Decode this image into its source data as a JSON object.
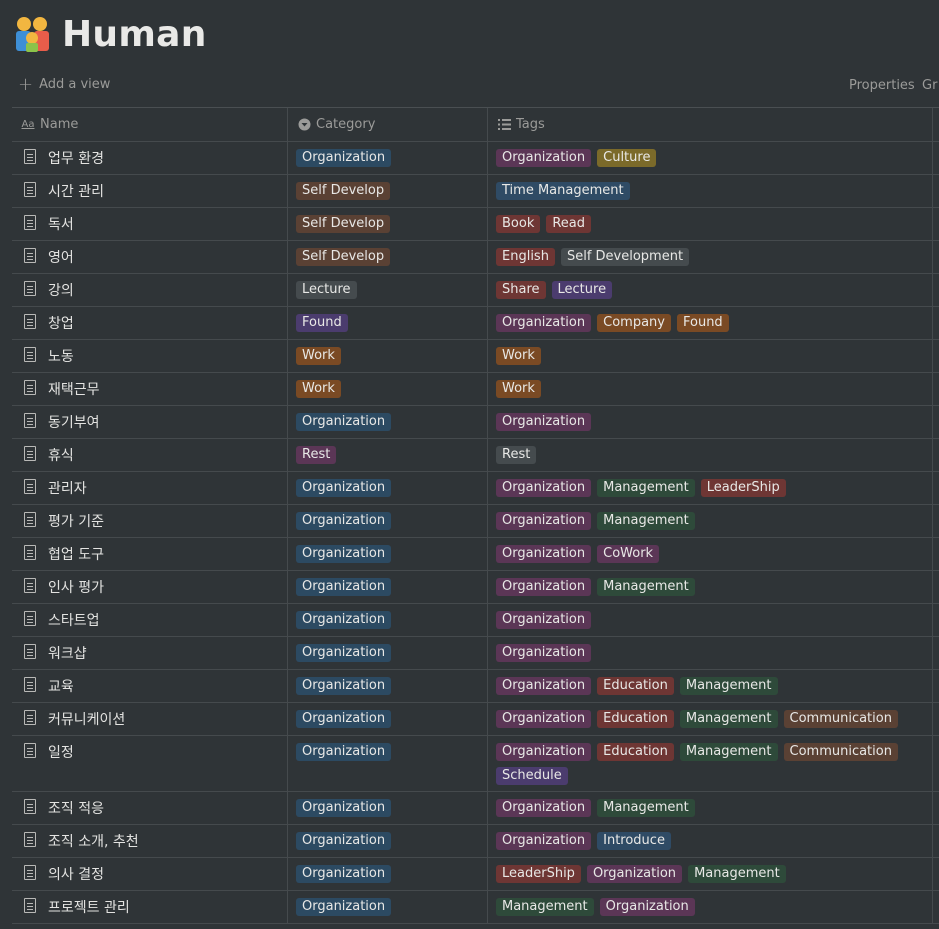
{
  "page": {
    "title": "Human",
    "icon": "family-emoji-icon"
  },
  "viewbar": {
    "add_view": "Add a view",
    "properties": "Properties",
    "group": "Gr"
  },
  "columns": {
    "name": "Name",
    "category": "Category",
    "tags": "Tags"
  },
  "colors": {
    "background": "#2f3437",
    "blue": "#2c4a62",
    "brown": "#5a4134",
    "gray": "#454b4e",
    "purple": "#4b3c6e",
    "orange": "#7a4a24",
    "red": "#6e3634",
    "pink": "#5b3656",
    "yellow": "#7b6a2a",
    "green": "#2e4a3a"
  },
  "rows": [
    {
      "name": "업무 환경",
      "category": {
        "label": "Organization",
        "color": "blue"
      },
      "tags": [
        {
          "label": "Organization",
          "color": "pink"
        },
        {
          "label": "Culture",
          "color": "yellow"
        }
      ]
    },
    {
      "name": "시간 관리",
      "category": {
        "label": "Self Develop",
        "color": "brown"
      },
      "tags": [
        {
          "label": "Time Management",
          "color": "tblue"
        }
      ]
    },
    {
      "name": "독서",
      "category": {
        "label": "Self Develop",
        "color": "brown"
      },
      "tags": [
        {
          "label": "Book",
          "color": "red"
        },
        {
          "label": "Read",
          "color": "red"
        }
      ]
    },
    {
      "name": "영어",
      "category": {
        "label": "Self Develop",
        "color": "brown"
      },
      "tags": [
        {
          "label": "English",
          "color": "red"
        },
        {
          "label": "Self Development",
          "color": "gray"
        }
      ]
    },
    {
      "name": "강의",
      "category": {
        "label": "Lecture",
        "color": "gray"
      },
      "tags": [
        {
          "label": "Share",
          "color": "red"
        },
        {
          "label": "Lecture",
          "color": "purple"
        }
      ]
    },
    {
      "name": "창업",
      "category": {
        "label": "Found",
        "color": "purple"
      },
      "tags": [
        {
          "label": "Organization",
          "color": "pink"
        },
        {
          "label": "Company",
          "color": "orange"
        },
        {
          "label": "Found",
          "color": "orange"
        }
      ]
    },
    {
      "name": "노동",
      "category": {
        "label": "Work",
        "color": "orange"
      },
      "tags": [
        {
          "label": "Work",
          "color": "orange"
        }
      ]
    },
    {
      "name": "재택근무",
      "category": {
        "label": "Work",
        "color": "orange"
      },
      "tags": [
        {
          "label": "Work",
          "color": "orange"
        }
      ]
    },
    {
      "name": "동기부여",
      "category": {
        "label": "Organization",
        "color": "blue"
      },
      "tags": [
        {
          "label": "Organization",
          "color": "pink"
        }
      ]
    },
    {
      "name": "휴식",
      "category": {
        "label": "Rest",
        "color": "pink"
      },
      "tags": [
        {
          "label": "Rest",
          "color": "gray"
        }
      ]
    },
    {
      "name": "관리자",
      "category": {
        "label": "Organization",
        "color": "blue"
      },
      "tags": [
        {
          "label": "Organization",
          "color": "pink"
        },
        {
          "label": "Management",
          "color": "green"
        },
        {
          "label": "LeaderShip",
          "color": "red"
        }
      ]
    },
    {
      "name": "평가 기준",
      "category": {
        "label": "Organization",
        "color": "blue"
      },
      "tags": [
        {
          "label": "Organization",
          "color": "pink"
        },
        {
          "label": "Management",
          "color": "green"
        }
      ]
    },
    {
      "name": "협업 도구",
      "category": {
        "label": "Organization",
        "color": "blue"
      },
      "tags": [
        {
          "label": "Organization",
          "color": "pink"
        },
        {
          "label": "CoWork",
          "color": "pink"
        }
      ]
    },
    {
      "name": "인사 평가",
      "category": {
        "label": "Organization",
        "color": "blue"
      },
      "tags": [
        {
          "label": "Organization",
          "color": "pink"
        },
        {
          "label": "Management",
          "color": "green"
        }
      ]
    },
    {
      "name": "스타트업",
      "category": {
        "label": "Organization",
        "color": "blue"
      },
      "tags": [
        {
          "label": "Organization",
          "color": "pink"
        }
      ]
    },
    {
      "name": "워크샵",
      "category": {
        "label": "Organization",
        "color": "blue"
      },
      "tags": [
        {
          "label": "Organization",
          "color": "pink"
        }
      ]
    },
    {
      "name": "교육",
      "category": {
        "label": "Organization",
        "color": "blue"
      },
      "tags": [
        {
          "label": "Organization",
          "color": "pink"
        },
        {
          "label": "Education",
          "color": "red"
        },
        {
          "label": "Management",
          "color": "green"
        }
      ]
    },
    {
      "name": "커뮤니케이션",
      "category": {
        "label": "Organization",
        "color": "blue"
      },
      "tags": [
        {
          "label": "Organization",
          "color": "pink"
        },
        {
          "label": "Education",
          "color": "red"
        },
        {
          "label": "Management",
          "color": "green"
        },
        {
          "label": "Communication",
          "color": "brown"
        }
      ]
    },
    {
      "name": "일정",
      "category": {
        "label": "Organization",
        "color": "blue"
      },
      "tags": [
        {
          "label": "Organization",
          "color": "pink"
        },
        {
          "label": "Education",
          "color": "red"
        },
        {
          "label": "Management",
          "color": "green"
        },
        {
          "label": "Communication",
          "color": "brown"
        },
        {
          "label": "Schedule",
          "color": "purple"
        }
      ]
    },
    {
      "name": "조직 적응",
      "category": {
        "label": "Organization",
        "color": "blue"
      },
      "tags": [
        {
          "label": "Organization",
          "color": "pink"
        },
        {
          "label": "Management",
          "color": "green"
        }
      ]
    },
    {
      "name": "조직 소개, 추천",
      "category": {
        "label": "Organization",
        "color": "blue"
      },
      "tags": [
        {
          "label": "Organization",
          "color": "pink"
        },
        {
          "label": "Introduce",
          "color": "tblue"
        }
      ]
    },
    {
      "name": "의사 결정",
      "category": {
        "label": "Organization",
        "color": "blue"
      },
      "tags": [
        {
          "label": "LeaderShip",
          "color": "red"
        },
        {
          "label": "Organization",
          "color": "pink"
        },
        {
          "label": "Management",
          "color": "green"
        }
      ]
    },
    {
      "name": "프로젝트 관리",
      "category": {
        "label": "Organization",
        "color": "blue"
      },
      "tags": [
        {
          "label": "Management",
          "color": "green"
        },
        {
          "label": "Organization",
          "color": "pink"
        }
      ]
    }
  ]
}
